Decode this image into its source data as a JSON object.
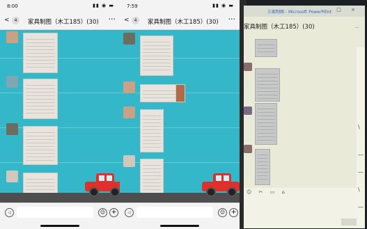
{
  "colors": {
    "chat_bg": "#33b7c9",
    "car": "#e0302c",
    "bar": "#f3f3f3"
  },
  "phone1": {
    "time": "8:00",
    "status_icons": "… ● ▬",
    "back_icon": "chevron-left-icon",
    "badge": "4",
    "title": "家具制图（木工185）(30)",
    "more": "···"
  },
  "phone2": {
    "time": "7:59",
    "status_icons": "… ● ▬",
    "back_icon": "chevron-left-icon",
    "badge": "4",
    "title": "家具制图（木工185）(30)",
    "more": "···"
  },
  "inputbar": {
    "voice": "◁",
    "emoji": "☺",
    "plus": "+"
  },
  "monitor": {
    "window_title": "三家制图 - Microsoft PowerPoint",
    "window_controls": "– □ ×",
    "chat_title": "家具制图（木工185）(30)",
    "chat_title_right": "...",
    "tools": "☺ ✂ ▭ ⌂",
    "side_icons": [
      "\\",
      "—",
      "—",
      "\\",
      "—"
    ]
  }
}
